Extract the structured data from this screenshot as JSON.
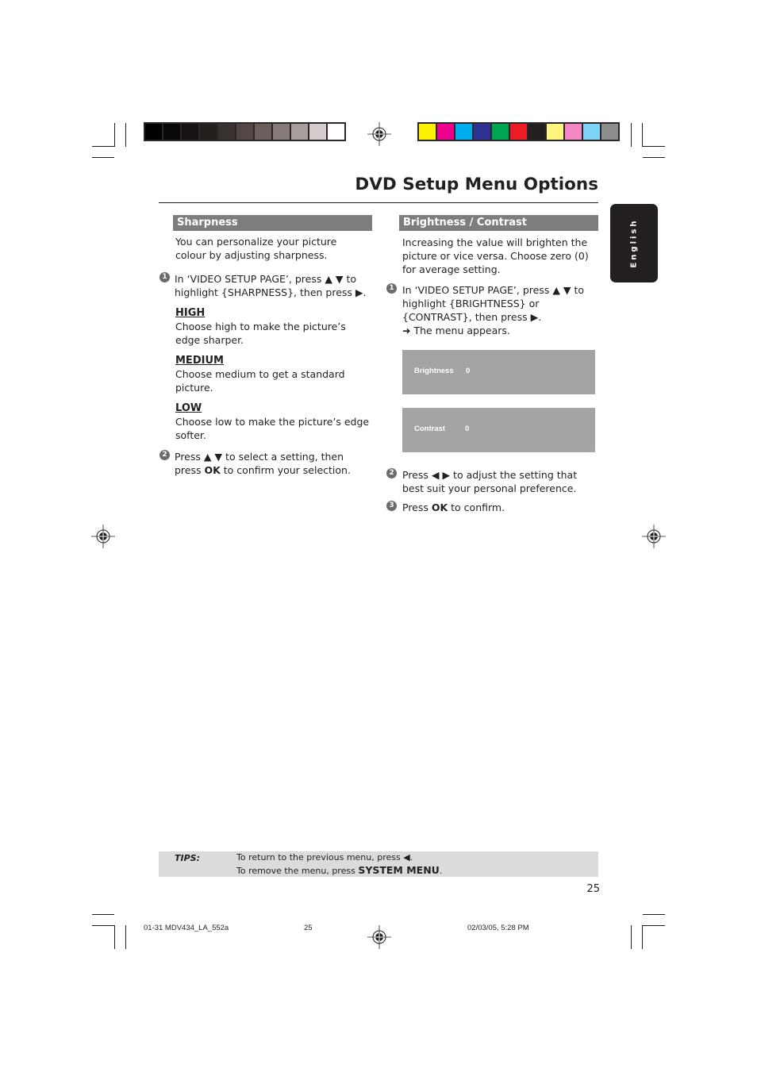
{
  "header": {
    "title": "DVD Setup Menu Options",
    "gray_swatches": [
      "#000000",
      "#0a0908",
      "#151211",
      "#231f1c",
      "#3a3230",
      "#524745",
      "#6b5f5c",
      "#857a77",
      "#a89f9d",
      "#d4cccb",
      "#ffffff"
    ],
    "color_swatches": [
      "#fff200",
      "#ec008c",
      "#00aeef",
      "#2e3192",
      "#00a651",
      "#ed1c24",
      "#231f20",
      "#fff57f",
      "#f587c6",
      "#7dd4f8",
      "#8e8d8d"
    ]
  },
  "side_tab": {
    "label": "English"
  },
  "sharpness": {
    "heading": "Sharpness",
    "intro": "You can personalize your picture colour by adjusting sharpness.",
    "step1_num": "1",
    "step1_line1": "In ‘VIDEO SETUP PAGE’, press ▲ ▼ to",
    "step1_line2": "highlight {SHARPNESS}, then press ▶.",
    "options": [
      {
        "name": "HIGH",
        "desc": "Choose high to make the picture’s edge sharper."
      },
      {
        "name": "MEDIUM",
        "desc": "Choose medium to get a standard picture."
      },
      {
        "name": "LOW",
        "desc": "Choose low to make the picture’s edge softer."
      }
    ],
    "step2_num": "2",
    "step2_pre": "Press ▲ ▼ to select a setting, then press",
    "step2_ok": "OK",
    "step2_post": " to confirm your selection."
  },
  "brightness": {
    "heading": "Brightness / Contrast",
    "intro": "Increasing the value will brighten the picture or vice versa. Choose zero (0) for average setting.",
    "step1_num": "1",
    "step1_line1": "In ‘VIDEO SETUP PAGE’, press ▲ ▼ to",
    "step1_line2": "highlight {BRIGHTNESS} or",
    "step1_line3": "{CONTRAST}, then press ▶.",
    "step1_result": "➜ The menu appears.",
    "menu": [
      {
        "label": "Brightness",
        "value": "0"
      },
      {
        "label": "Contrast",
        "value": "0"
      }
    ],
    "step2_num": "2",
    "step2_text": "Press ◀ ▶ to adjust the setting that best suit your personal preference.",
    "step3_num": "3",
    "step3_pre": "Press ",
    "step3_ok": "OK",
    "step3_post": " to confirm."
  },
  "tips": {
    "label": "TIPS:",
    "line1": "To return to the previous menu, press ◀.",
    "line2_pre": "To remove the menu, press ",
    "line2_bold": "SYSTEM MENU",
    "line2_post": "."
  },
  "page_number": "25",
  "slug": {
    "file": "01-31 MDV434_LA_552a",
    "page": "25",
    "date": "02/03/05, 5:28 PM"
  }
}
